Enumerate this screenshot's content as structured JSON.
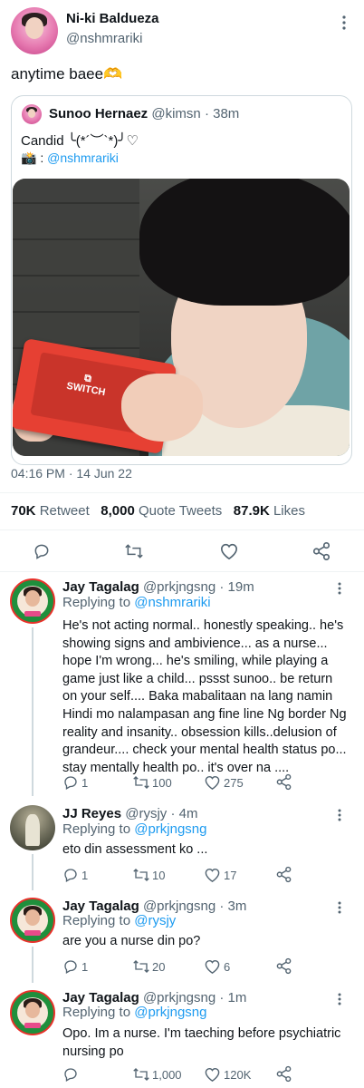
{
  "tweet": {
    "author_name": "Ni-ki Baldueza",
    "author_handle": "@nshmrariki",
    "text": "anytime baee🫶",
    "timestamp": "04:16 PM · 14 Jun 22",
    "stats": {
      "retweets": "70K",
      "retweets_label": "Retweet",
      "quotes": "8,000",
      "quotes_label": "Quote Tweets",
      "likes": "87.9K",
      "likes_label": "Likes"
    }
  },
  "quoted": {
    "author_name": "Sunoo Hernaez",
    "author_handle": "@kimsn",
    "time": "· 38m",
    "line1": "Candid ╰(*´︶`*)╯♡",
    "line2_prefix": "📸 : ",
    "line2_mention": "@nshmrariki"
  },
  "replies": [
    {
      "name": "Jay Tagalag",
      "handle": "@prkjngsng",
      "time": "· 19m",
      "replying_label": "Replying to",
      "replying_to": "@nshmrariki",
      "text": "He's not acting normal.. honestly speaking.. he's showing signs and ambivience... as a nurse... hope I'm wrong... he's smiling, while playing a game just like a child... pssst sunoo.. be return on your self.... Baka mabalitaan na lang namin Hindi mo nalampasan ang fine line Ng border Ng reality and insanity.. obsession kills..delusion of grandeur.... check your mental health status po... stay mentally health po.. it's over na ....",
      "replies": "1",
      "retweets": "100",
      "likes": "275"
    },
    {
      "name": "JJ Reyes",
      "handle": "@rysjy",
      "time": "· 4m",
      "replying_label": "Replying to",
      "replying_to": "@prkjngsng",
      "text": "eto din assessment ko ...",
      "replies": "1",
      "retweets": "10",
      "likes": "17"
    },
    {
      "name": "Jay Tagalag",
      "handle": "@prkjngsng",
      "time": "· 3m",
      "replying_label": "Replying to",
      "replying_to": "@rysjy",
      "text": "are you a nurse din po?",
      "replies": "1",
      "retweets": "20",
      "likes": "6"
    },
    {
      "name": "Jay Tagalag",
      "handle": "@prkjngsng",
      "time": "· 1m",
      "replying_label": "Replying to",
      "replying_to": "@prkjngsng",
      "text": "Opo. Im a nurse. I'm taeching before psychiatric nursing po",
      "replies": "",
      "retweets": "1,000",
      "likes": "120K"
    }
  ],
  "icons": {
    "more": "more-icon",
    "reply": "reply-icon",
    "retweet": "retweet-icon",
    "like": "heart-icon",
    "share": "share-icon"
  },
  "colors": {
    "link": "#1d9bf0",
    "muted": "#536471",
    "divider": "#eff3f4"
  }
}
